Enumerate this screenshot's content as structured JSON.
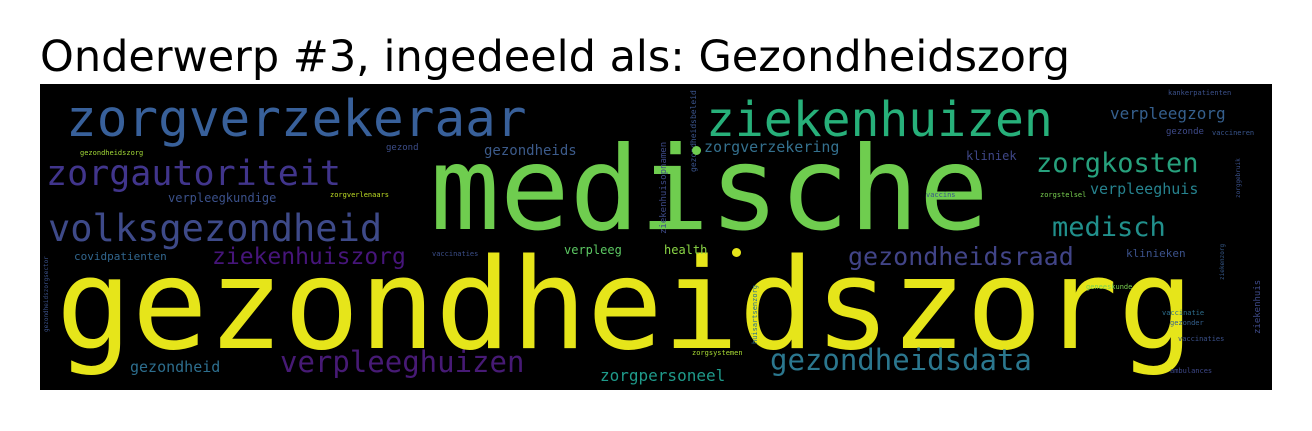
{
  "title": "Onderwerp #3, ingedeeld als: Gezondheidszorg",
  "words": [
    {
      "key": "gezondheidszorg",
      "text": "gezondheidszorg",
      "color": "#e6e51a"
    },
    {
      "key": "medische",
      "text": "medische",
      "color": "#6fcd4f"
    },
    {
      "key": "zorgverzekeraar",
      "text": "zorgverzekeraar",
      "color": "#38609a"
    },
    {
      "key": "ziekenhuizen",
      "text": "ziekenhuizen",
      "color": "#27b07a"
    },
    {
      "key": "zorgautoriteit",
      "text": "zorgautoriteit",
      "color": "#41358c"
    },
    {
      "key": "volksgezondheid",
      "text": "volksgezondheid",
      "color": "#3e4a89"
    },
    {
      "key": "zorgkosten",
      "text": "zorgkosten",
      "color": "#27a17d"
    },
    {
      "key": "medisch",
      "text": "medisch",
      "color": "#21908c"
    },
    {
      "key": "gezondheidsraad",
      "text": "gezondheidsraad",
      "color": "#414487"
    },
    {
      "key": "ziekenhuiszorg",
      "text": "ziekenhuiszorg",
      "color": "#46157a"
    },
    {
      "key": "verpleeghuizen",
      "text": "verpleeghuizen",
      "color": "#471a75"
    },
    {
      "key": "gezondheidsdata",
      "text": "gezondheidsdata",
      "color": "#2b778e"
    },
    {
      "key": "zorgpersoneel",
      "text": "zorgpersoneel",
      "color": "#1f9a8a"
    },
    {
      "key": "verpleegzorg",
      "text": "verpleegzorg",
      "color": "#355f8d"
    },
    {
      "key": "verpleeghuis",
      "text": "verpleeghuis",
      "color": "#26828e"
    },
    {
      "key": "gezondheids",
      "text": "gezondheids",
      "color": "#3c5b8b"
    },
    {
      "key": "zorgverzekering",
      "text": "zorgverzekering",
      "color": "#34708e"
    },
    {
      "key": "gezondheid",
      "text": "gezondheid",
      "color": "#2d6e8e"
    },
    {
      "key": "verpleegkundige",
      "text": "verpleegkundige",
      "color": "#3b518b"
    },
    {
      "key": "covidpatienten",
      "text": "covidpatienten",
      "color": "#31668e"
    },
    {
      "key": "kliniek",
      "text": "kliniek",
      "color": "#3f4788"
    },
    {
      "key": "klinieken",
      "text": "klinieken",
      "color": "#3b528b"
    },
    {
      "key": "verpleeg",
      "text": "verpleeg",
      "color": "#5cc863"
    },
    {
      "key": "health",
      "text": "health",
      "color": "#8bd646"
    },
    {
      "key": "gezond",
      "text": "gezond",
      "color": "#3d4e8a"
    },
    {
      "key": "gezonde",
      "text": "gezonde",
      "color": "#3e4a89"
    },
    {
      "key": "vaccineren",
      "text": "vaccineren",
      "color": "#39558c"
    },
    {
      "key": "gezondheidszorg_small",
      "text": "gezondheidszorg",
      "color": "#a2da37"
    },
    {
      "key": "zorgverlenaars",
      "text": "zorgverlenaars",
      "color": "#c0df25"
    },
    {
      "key": "zorgstelsel",
      "text": "zorgstelsel",
      "color": "#7ad151"
    },
    {
      "key": "vaccinaties",
      "text": "vaccinaties",
      "color": "#3c4f8a"
    },
    {
      "key": "vaccins",
      "text": "vaccins",
      "color": "#3a548c"
    },
    {
      "key": "vaccinatie",
      "text": "vaccinatie",
      "color": "#2e6f8e"
    },
    {
      "key": "kankerpatienten",
      "text": "kankerpatienten",
      "color": "#3b518b"
    },
    {
      "key": "gezonder",
      "text": "gezonder",
      "color": "#34608d"
    },
    {
      "key": "geneeskunde",
      "text": "geneeskunde",
      "color": "#7ad151"
    },
    {
      "key": "zorgsystemen",
      "text": "zorgsystemen",
      "color": "#a8db34"
    },
    {
      "key": "ambulances",
      "text": "ambulances",
      "color": "#3e4989"
    },
    {
      "key": "vaccinaties_b",
      "text": "vaccinaties",
      "color": "#3b518b"
    },
    {
      "key": "ziekenhuisopnamen",
      "text": "ziekenhuisopnamen",
      "color": "#3e4a89"
    },
    {
      "key": "gezondheidsorg_v",
      "text": "gezondheidszorgsector",
      "color": "#3b528b"
    },
    {
      "key": "ziekenzorg_v",
      "text": "ziekenzorg",
      "color": "#375b8d"
    },
    {
      "key": "huisartsenzorg_v",
      "text": "huisartsenzorg",
      "color": "#2c728e"
    },
    {
      "key": "zorggebruik_v",
      "text": "zorggebruik",
      "color": "#3b518b"
    },
    {
      "key": "ziekenhuis_v",
      "text": "ziekenhuis",
      "color": "#3e4a89"
    },
    {
      "key": "gezondheidsbeleid_v",
      "text": "gezondheidsbeleid",
      "color": "#3a548c"
    }
  ]
}
